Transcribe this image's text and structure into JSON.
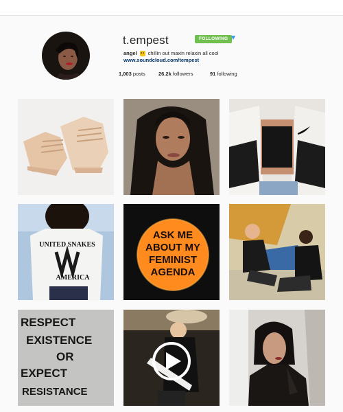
{
  "profile": {
    "username": "t.empest",
    "follow_label": "FOLLOWING",
    "bio_name": "angel",
    "bio_text": "chillin out maxin relaxin all cool",
    "bio_emoji": "smiling-face-emoji",
    "link": "www.soundcloud.com/tempest",
    "stats": {
      "posts_count": "1,003",
      "posts_label": "posts",
      "followers_count": "26.2k",
      "followers_label": "followers",
      "following_count": "91",
      "following_label": "following"
    }
  },
  "posts": [
    {
      "name": "beige-sneakers-photo",
      "text": []
    },
    {
      "name": "portrait-braids-photo",
      "text": []
    },
    {
      "name": "track-jacket-photo",
      "text": []
    },
    {
      "name": "united-snakes-shirt-photo",
      "text": [
        "UNITED SNAKES",
        "AMERICA"
      ]
    },
    {
      "name": "feminist-button-photo",
      "text": [
        "ASK ME",
        "ABOUT MY",
        "FEMINIST",
        "AGENDA"
      ]
    },
    {
      "name": "band-group-photo",
      "text": []
    },
    {
      "name": "graffiti-wall-photo",
      "text": [
        "RESPECT",
        "EXISTENCE",
        "OR",
        "EXPECT",
        "RESISTANCE"
      ]
    },
    {
      "name": "guitar-performance-video",
      "text": []
    },
    {
      "name": "leather-jacket-portrait-photo",
      "text": []
    }
  ],
  "icons": {
    "dropdown": "caret-down-icon",
    "video": "video-play-icon"
  },
  "colors": {
    "follow_green": "#70c050",
    "link_blue": "#003569",
    "caret_blue": "#3897f0"
  }
}
